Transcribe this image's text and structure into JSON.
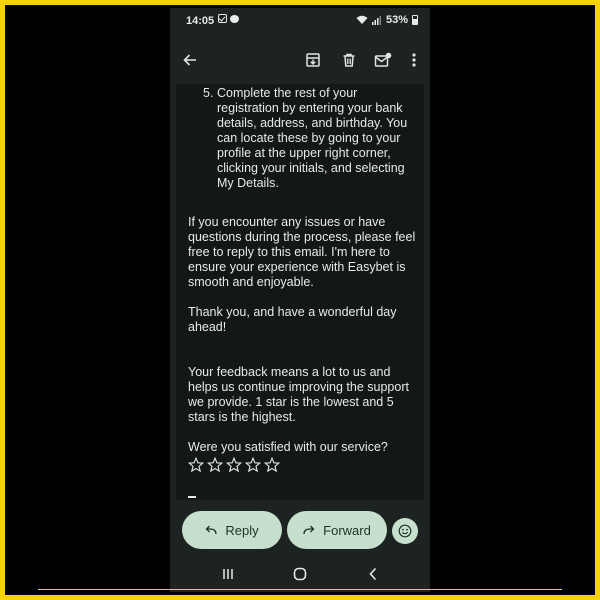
{
  "status": {
    "time": "14:05",
    "battery": "53%"
  },
  "toolbar": {
    "icons": [
      "back-arrow-icon",
      "archive-icon",
      "trash-icon",
      "mark-unread-icon",
      "more-vert-icon"
    ]
  },
  "email": {
    "list_item": {
      "number": "5.",
      "text": "Complete the rest of your registration by entering your bank details, address, and birthday. You can locate these by going to your profile at the upper right corner, clicking your initials, and selecting My Details."
    },
    "paragraph_issues": "If you encounter any issues or have questions during the process, please feel free to reply to this email. I'm here to ensure your experience with Easybet is smooth and enjoyable.",
    "paragraph_thanks": "Thank you, and have a wonderful day ahead!",
    "paragraph_feedback": "Your feedback means a lot to us and helps us continue improving the support we provide. 1 star is the lowest and 5 stars is the highest.",
    "question": "Were you satisfied with our service?",
    "rating": {
      "max": 5,
      "value": 0
    }
  },
  "actions": {
    "reply_label": "Reply",
    "forward_label": "Forward"
  },
  "colors": {
    "frame": "#f5d30c",
    "background": "#1d2320",
    "pill": "#c7e0cd",
    "text": "#e6ebe7"
  }
}
